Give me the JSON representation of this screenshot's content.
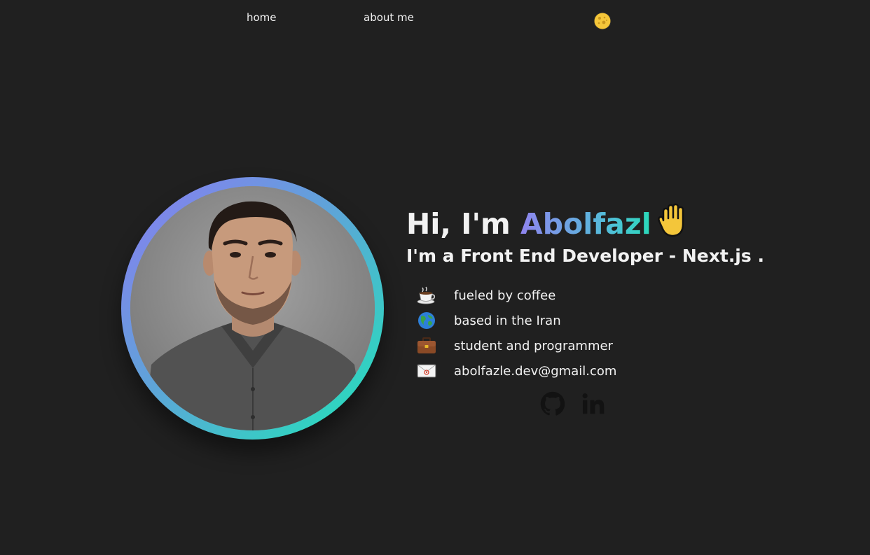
{
  "nav": {
    "home_label": "home",
    "about_label": "about me",
    "theme_toggle_icon": "moon-icon"
  },
  "hero": {
    "greeting_prefix": "Hi, I'm ",
    "name": "Abolfazl",
    "wave_icon": "raised-hand-icon",
    "subtitle": "I'm a Front End Developer - Next.js .",
    "gradient_colors": [
      "#8b7bf2",
      "#5fa3d9",
      "#1fe5b8"
    ]
  },
  "facts": [
    {
      "icon": "coffee-icon",
      "text": "fueled by coffee"
    },
    {
      "icon": "globe-icon",
      "text": "based in the Iran"
    },
    {
      "icon": "briefcase-icon",
      "text": "student and programmer"
    },
    {
      "icon": "envelope-icon",
      "text": "abolfazle.dev@gmail.com"
    }
  ],
  "social": [
    {
      "icon": "github-icon"
    },
    {
      "icon": "linkedin-icon"
    }
  ],
  "colors": {
    "background": "#202020",
    "text": "#f2f2f2",
    "social_icon": "#111111"
  }
}
